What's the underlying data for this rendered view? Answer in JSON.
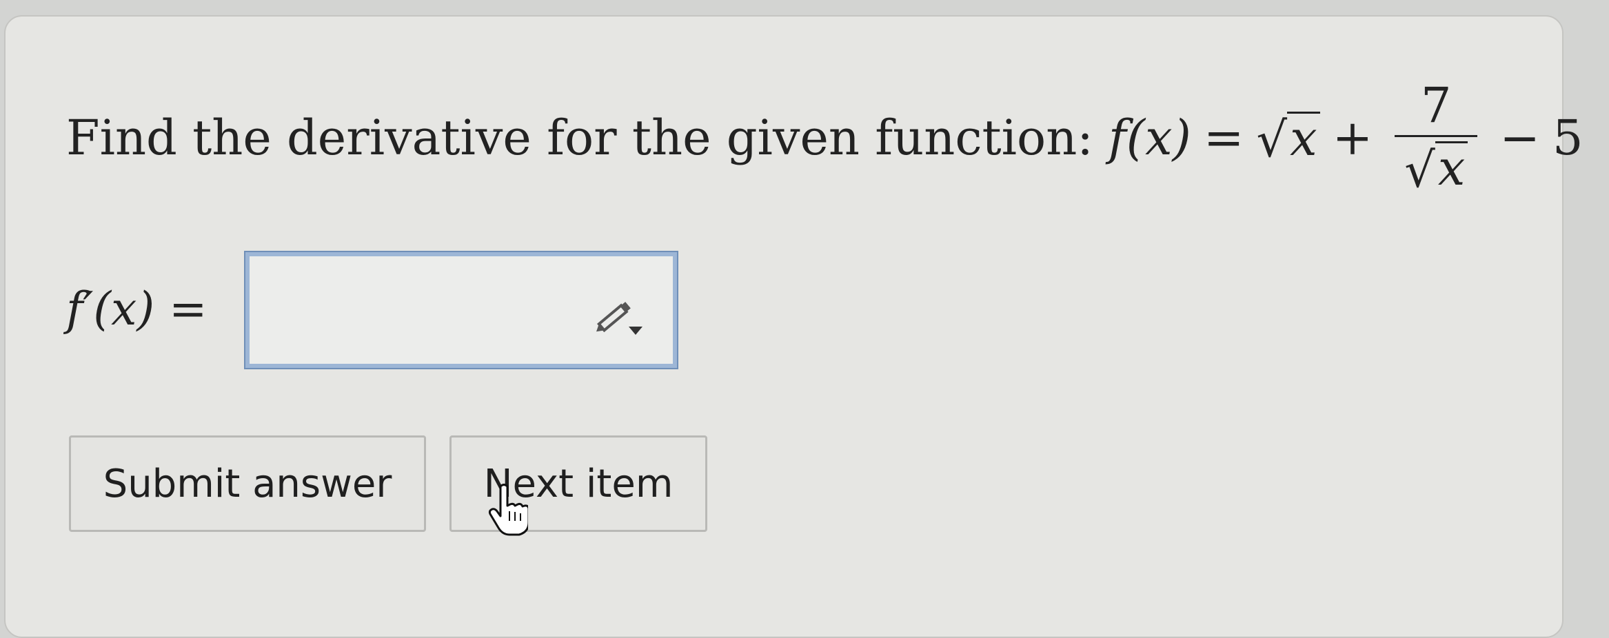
{
  "question": {
    "prompt": "Find the derivative for the given function:",
    "function_lhs": "f(x)",
    "equals": "=",
    "sqrt_symbol": "√",
    "radicand": "x",
    "plus": "+",
    "fraction_numerator": "7",
    "minus": "−",
    "constant": "5"
  },
  "answer": {
    "label": "f′(x) =",
    "value": "",
    "editor_icon": "pencil-icon"
  },
  "buttons": {
    "submit_label": "Submit answer",
    "next_label": "Next item"
  },
  "cursor": {
    "icon": "hand-pointer-icon"
  },
  "colors": {
    "page_background": "#d3d4d2",
    "card_background": "#e6e6e3",
    "input_border": "#9db6d6"
  }
}
